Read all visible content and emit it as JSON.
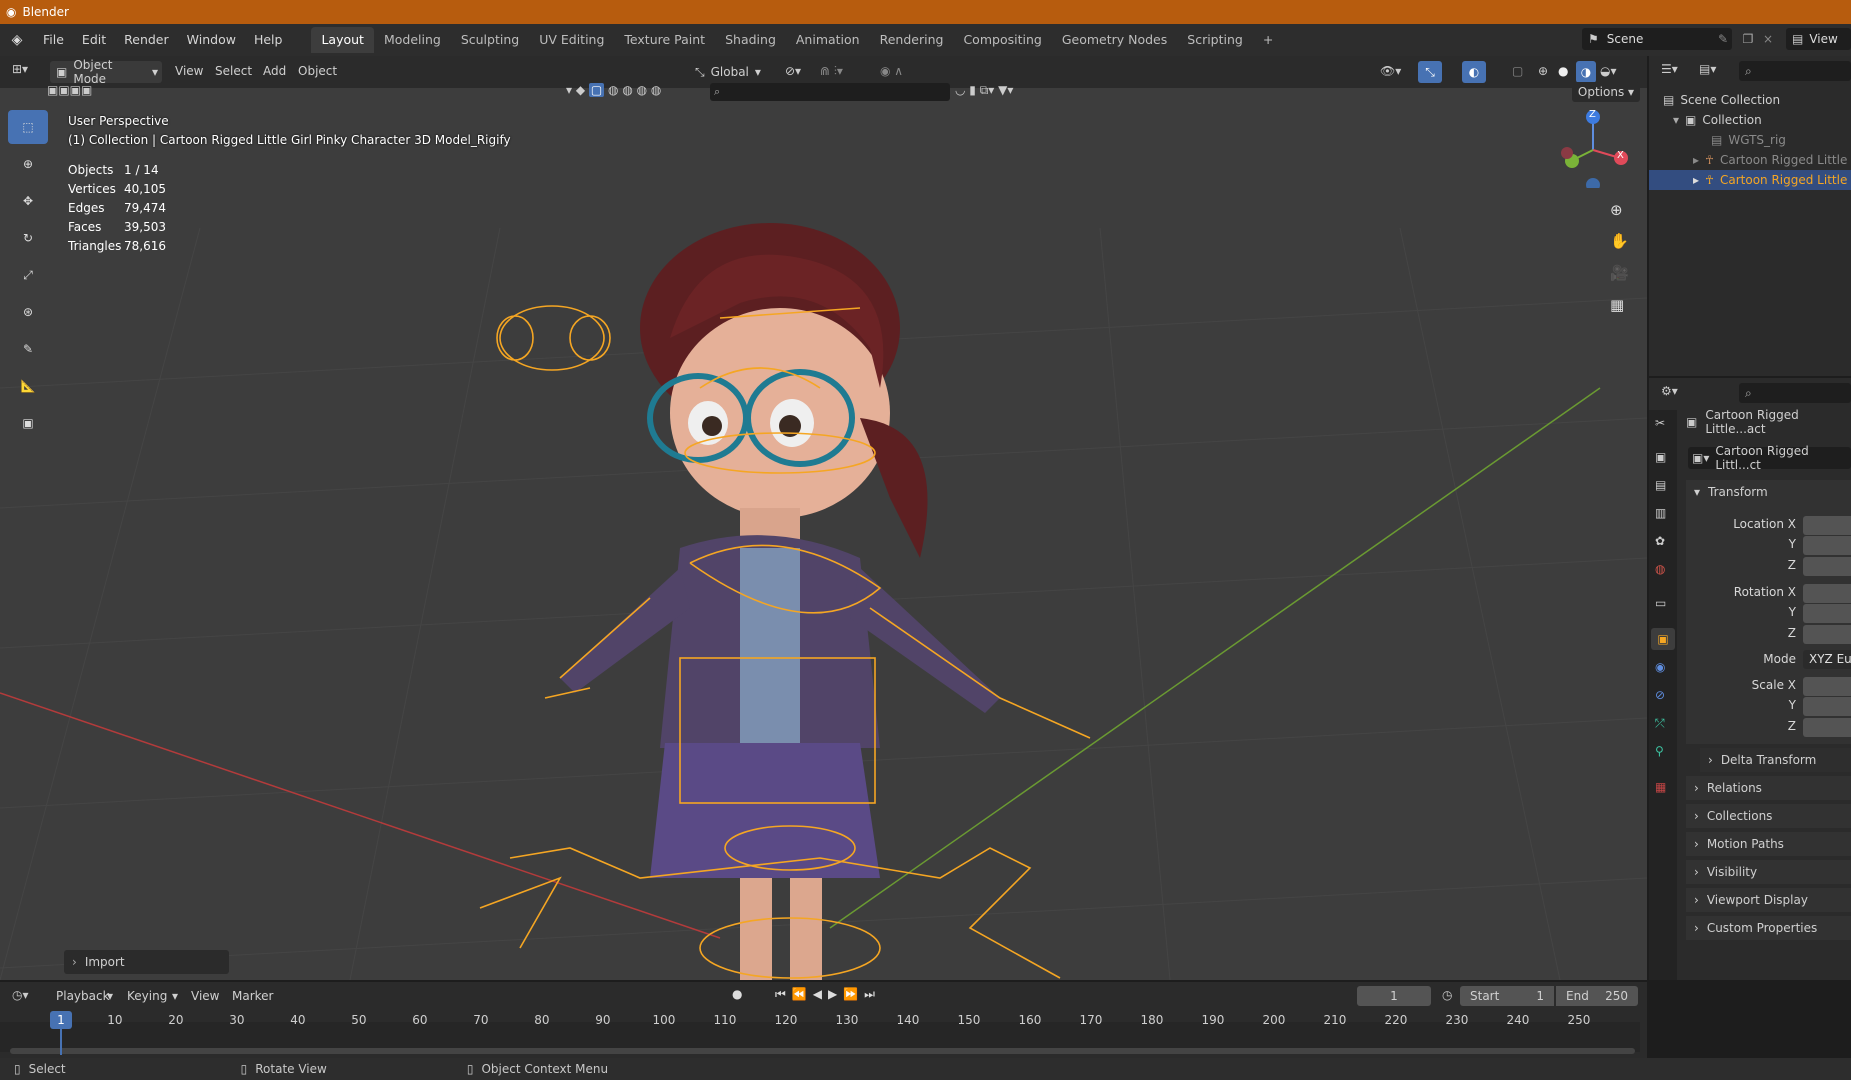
{
  "title_bar": {
    "app_name": "Blender"
  },
  "menu": [
    "File",
    "Edit",
    "Render",
    "Window",
    "Help"
  ],
  "workspaces": [
    "Layout",
    "Modeling",
    "Sculpting",
    "UV Editing",
    "Texture Paint",
    "Shading",
    "Animation",
    "Rendering",
    "Compositing",
    "Geometry Nodes",
    "Scripting"
  ],
  "workspace_add": "+",
  "scene": {
    "name": "Scene",
    "view_layer": "View"
  },
  "viewport_header": {
    "mode": "Object Mode",
    "menus": [
      "View",
      "Select",
      "Add",
      "Object"
    ],
    "orientation": "Global",
    "options": "Options"
  },
  "viewport_info": {
    "perspective": "User Perspective",
    "collection_line": "(1) Collection | Cartoon Rigged Little Girl Pinky Character 3D Model_Rigify",
    "stats": [
      {
        "label": "Objects",
        "value": "1 / 14"
      },
      {
        "label": "Vertices",
        "value": "40,105"
      },
      {
        "label": "Edges",
        "value": "79,474"
      },
      {
        "label": "Faces",
        "value": "39,503"
      },
      {
        "label": "Triangles",
        "value": "78,616"
      }
    ]
  },
  "gizmo_axes": {
    "z": "Z",
    "x": "X"
  },
  "import_panel": "Import",
  "outliner": {
    "scene_collection": "Scene Collection",
    "collection": "Collection",
    "items": [
      "WGTS_rig",
      "Cartoon Rigged Little G",
      "Cartoon Rigged Little G"
    ]
  },
  "properties": {
    "object_name": "Cartoon Rigged Little...act",
    "data_name": "Cartoon Rigged Littl...ct",
    "transform": "Transform",
    "location_label": "Location X",
    "rotation_label": "Rotation X",
    "scale_label": "Scale X",
    "axis_y": "Y",
    "axis_z": "Z",
    "mode_label": "Mode",
    "mode_value": "XYZ Eul",
    "delta": "Delta Transform",
    "sections": [
      "Relations",
      "Collections",
      "Motion Paths",
      "Visibility",
      "Viewport Display",
      "Custom Properties"
    ]
  },
  "timeline": {
    "menus": [
      "Playback",
      "Keying",
      "View",
      "Marker"
    ],
    "current_frame": "1",
    "start_label": "Start",
    "start": "1",
    "end_label": "End",
    "end": "250",
    "ticks": [
      "1",
      "10",
      "20",
      "30",
      "40",
      "50",
      "60",
      "70",
      "80",
      "90",
      "100",
      "110",
      "120",
      "130",
      "140",
      "150",
      "160",
      "170",
      "180",
      "190",
      "200",
      "210",
      "220",
      "230",
      "240",
      "250"
    ]
  },
  "status_bar": {
    "select": "Select",
    "rotate": "Rotate View",
    "context": "Object Context Menu"
  },
  "colors": {
    "accent": "#4772b3",
    "title": "#b75c0e",
    "selection": "#f5a623"
  }
}
